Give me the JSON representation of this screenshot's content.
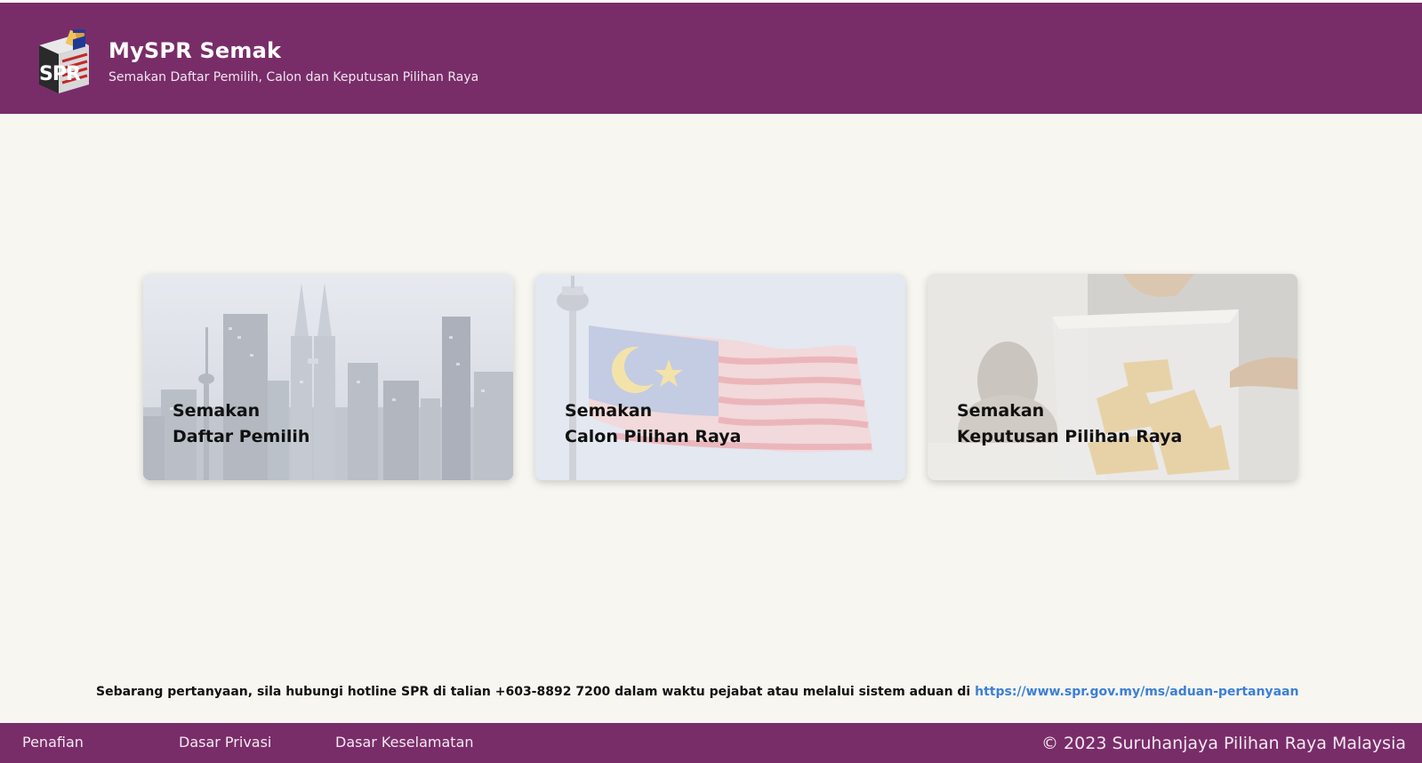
{
  "header": {
    "title": "MySPR Semak",
    "subtitle": "Semakan Daftar Pemilih, Calon dan Keputusan Pilihan Raya",
    "logo_text": "SPR"
  },
  "cards": [
    {
      "line1": "Semakan",
      "line2": "Daftar Pemilih",
      "image": "city-skyline-image"
    },
    {
      "line1": "Semakan",
      "line2": "Calon Pilihan Raya",
      "image": "malaysia-flag-image"
    },
    {
      "line1": "Semakan",
      "line2": "Keputusan Pilihan Raya",
      "image": "ballot-box-image"
    }
  ],
  "contact": {
    "text": "Sebarang pertanyaan, sila hubungi hotline SPR di talian +603-8892 7200 dalam waktu pejabat atau melalui sistem aduan di ",
    "link": "https://www.spr.gov.my/ms/aduan-pertanyaan"
  },
  "footer": {
    "links": [
      "Penafian",
      "Dasar Privasi",
      "Dasar Keselamatan"
    ],
    "copyright": "© 2023 Suruhanjaya Pilihan Raya Malaysia"
  },
  "colors": {
    "brand": "#782d69",
    "background": "#f7f6f1",
    "link": "#3b7fd6"
  }
}
